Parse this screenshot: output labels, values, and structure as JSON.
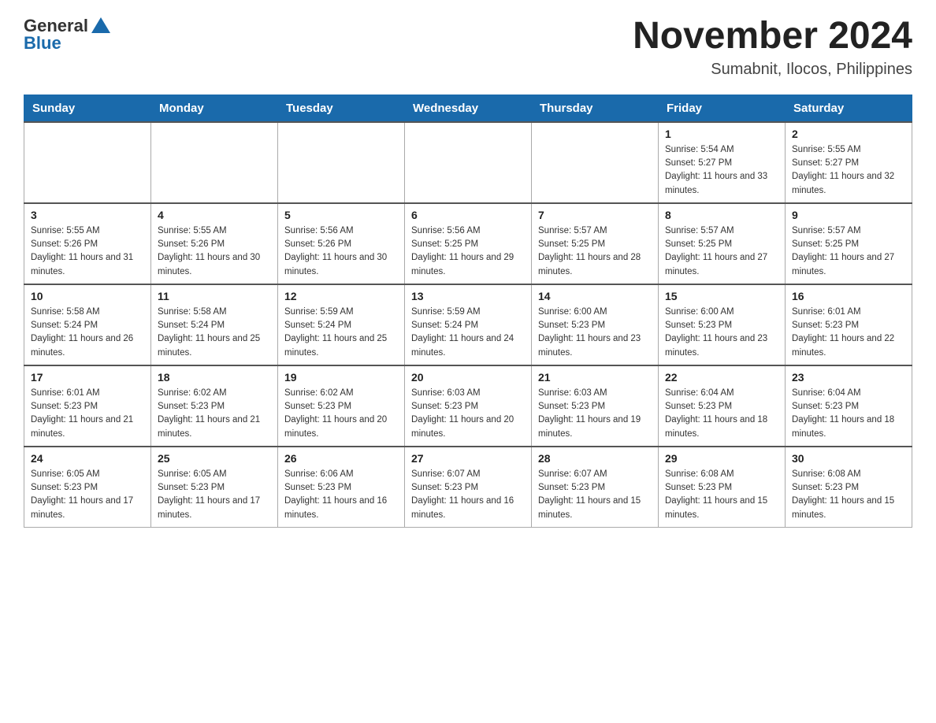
{
  "logo": {
    "general": "General",
    "blue": "Blue"
  },
  "header": {
    "month": "November 2024",
    "location": "Sumabnit, Ilocos, Philippines"
  },
  "days_of_week": [
    "Sunday",
    "Monday",
    "Tuesday",
    "Wednesday",
    "Thursday",
    "Friday",
    "Saturday"
  ],
  "weeks": [
    [
      {
        "day": "",
        "info": ""
      },
      {
        "day": "",
        "info": ""
      },
      {
        "day": "",
        "info": ""
      },
      {
        "day": "",
        "info": ""
      },
      {
        "day": "",
        "info": ""
      },
      {
        "day": "1",
        "info": "Sunrise: 5:54 AM\nSunset: 5:27 PM\nDaylight: 11 hours and 33 minutes."
      },
      {
        "day": "2",
        "info": "Sunrise: 5:55 AM\nSunset: 5:27 PM\nDaylight: 11 hours and 32 minutes."
      }
    ],
    [
      {
        "day": "3",
        "info": "Sunrise: 5:55 AM\nSunset: 5:26 PM\nDaylight: 11 hours and 31 minutes."
      },
      {
        "day": "4",
        "info": "Sunrise: 5:55 AM\nSunset: 5:26 PM\nDaylight: 11 hours and 30 minutes."
      },
      {
        "day": "5",
        "info": "Sunrise: 5:56 AM\nSunset: 5:26 PM\nDaylight: 11 hours and 30 minutes."
      },
      {
        "day": "6",
        "info": "Sunrise: 5:56 AM\nSunset: 5:25 PM\nDaylight: 11 hours and 29 minutes."
      },
      {
        "day": "7",
        "info": "Sunrise: 5:57 AM\nSunset: 5:25 PM\nDaylight: 11 hours and 28 minutes."
      },
      {
        "day": "8",
        "info": "Sunrise: 5:57 AM\nSunset: 5:25 PM\nDaylight: 11 hours and 27 minutes."
      },
      {
        "day": "9",
        "info": "Sunrise: 5:57 AM\nSunset: 5:25 PM\nDaylight: 11 hours and 27 minutes."
      }
    ],
    [
      {
        "day": "10",
        "info": "Sunrise: 5:58 AM\nSunset: 5:24 PM\nDaylight: 11 hours and 26 minutes."
      },
      {
        "day": "11",
        "info": "Sunrise: 5:58 AM\nSunset: 5:24 PM\nDaylight: 11 hours and 25 minutes."
      },
      {
        "day": "12",
        "info": "Sunrise: 5:59 AM\nSunset: 5:24 PM\nDaylight: 11 hours and 25 minutes."
      },
      {
        "day": "13",
        "info": "Sunrise: 5:59 AM\nSunset: 5:24 PM\nDaylight: 11 hours and 24 minutes."
      },
      {
        "day": "14",
        "info": "Sunrise: 6:00 AM\nSunset: 5:23 PM\nDaylight: 11 hours and 23 minutes."
      },
      {
        "day": "15",
        "info": "Sunrise: 6:00 AM\nSunset: 5:23 PM\nDaylight: 11 hours and 23 minutes."
      },
      {
        "day": "16",
        "info": "Sunrise: 6:01 AM\nSunset: 5:23 PM\nDaylight: 11 hours and 22 minutes."
      }
    ],
    [
      {
        "day": "17",
        "info": "Sunrise: 6:01 AM\nSunset: 5:23 PM\nDaylight: 11 hours and 21 minutes."
      },
      {
        "day": "18",
        "info": "Sunrise: 6:02 AM\nSunset: 5:23 PM\nDaylight: 11 hours and 21 minutes."
      },
      {
        "day": "19",
        "info": "Sunrise: 6:02 AM\nSunset: 5:23 PM\nDaylight: 11 hours and 20 minutes."
      },
      {
        "day": "20",
        "info": "Sunrise: 6:03 AM\nSunset: 5:23 PM\nDaylight: 11 hours and 20 minutes."
      },
      {
        "day": "21",
        "info": "Sunrise: 6:03 AM\nSunset: 5:23 PM\nDaylight: 11 hours and 19 minutes."
      },
      {
        "day": "22",
        "info": "Sunrise: 6:04 AM\nSunset: 5:23 PM\nDaylight: 11 hours and 18 minutes."
      },
      {
        "day": "23",
        "info": "Sunrise: 6:04 AM\nSunset: 5:23 PM\nDaylight: 11 hours and 18 minutes."
      }
    ],
    [
      {
        "day": "24",
        "info": "Sunrise: 6:05 AM\nSunset: 5:23 PM\nDaylight: 11 hours and 17 minutes."
      },
      {
        "day": "25",
        "info": "Sunrise: 6:05 AM\nSunset: 5:23 PM\nDaylight: 11 hours and 17 minutes."
      },
      {
        "day": "26",
        "info": "Sunrise: 6:06 AM\nSunset: 5:23 PM\nDaylight: 11 hours and 16 minutes."
      },
      {
        "day": "27",
        "info": "Sunrise: 6:07 AM\nSunset: 5:23 PM\nDaylight: 11 hours and 16 minutes."
      },
      {
        "day": "28",
        "info": "Sunrise: 6:07 AM\nSunset: 5:23 PM\nDaylight: 11 hours and 15 minutes."
      },
      {
        "day": "29",
        "info": "Sunrise: 6:08 AM\nSunset: 5:23 PM\nDaylight: 11 hours and 15 minutes."
      },
      {
        "day": "30",
        "info": "Sunrise: 6:08 AM\nSunset: 5:23 PM\nDaylight: 11 hours and 15 minutes."
      }
    ]
  ]
}
